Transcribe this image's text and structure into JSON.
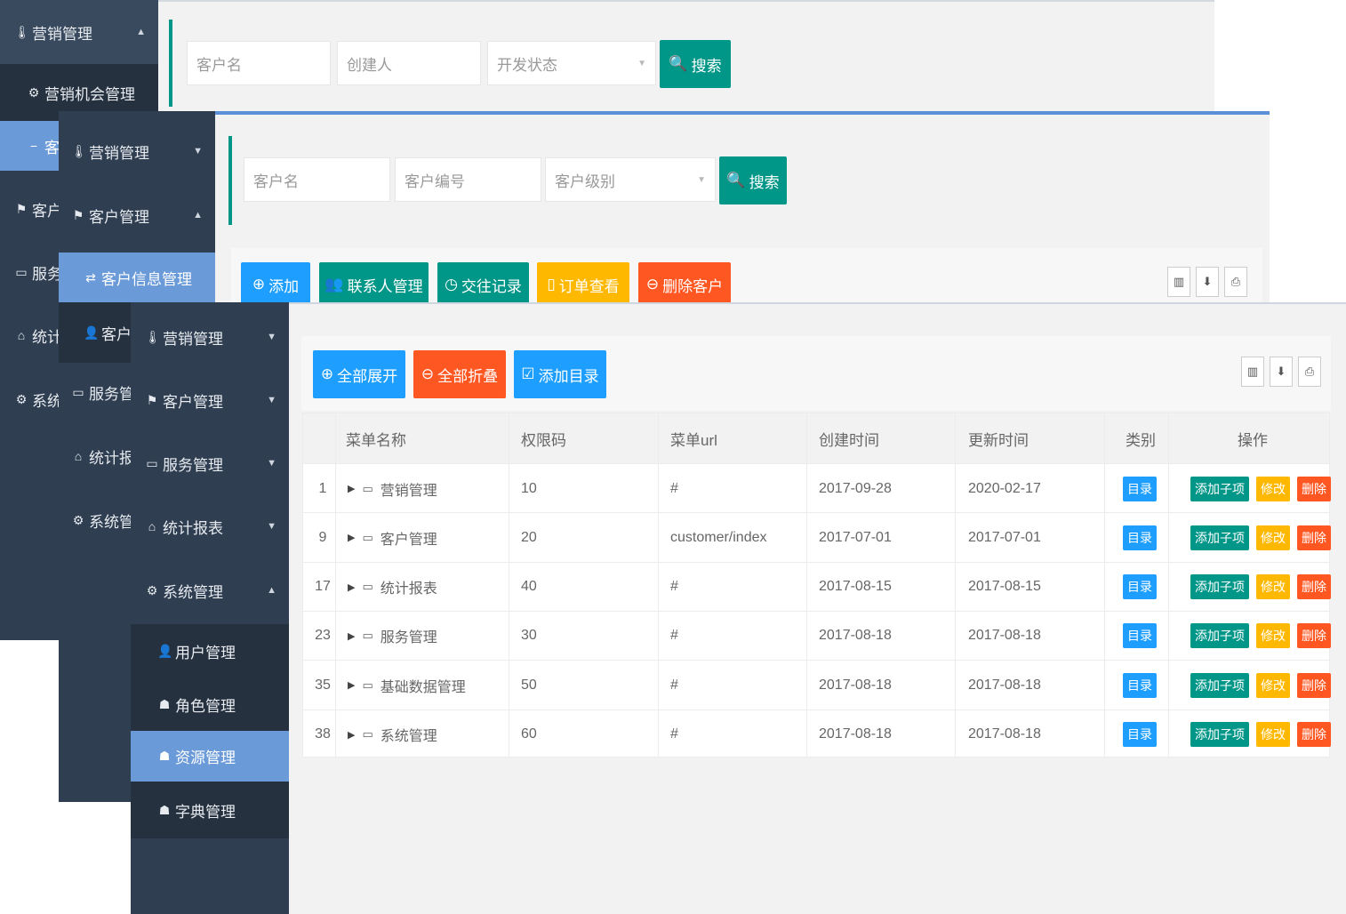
{
  "layer1": {
    "nav": {
      "marketing": "营销管理",
      "opportunity": "营销机会管理",
      "customer_partial": "客",
      "customer_mgmt_partial": "客户管",
      "service_partial": "服务",
      "stats_partial": "统计报",
      "system_partial": "系统管"
    },
    "search": {
      "customer_name_placeholder": "客户名",
      "creator_placeholder": "创建人",
      "dev_status_placeholder": "开发状态",
      "search_label": "搜索"
    }
  },
  "layer2": {
    "nav": {
      "marketing": "营销管理",
      "customer": "客户管理",
      "customer_info": "客户信息管理",
      "customer_loss_partial": "客户",
      "service": "服务管理",
      "stats": "统计报表",
      "system": "系统管理"
    },
    "search": {
      "customer_name_placeholder": "客户名",
      "customer_no_placeholder": "客户编号",
      "customer_level_placeholder": "客户级别",
      "search_label": "搜索"
    },
    "toolbar": {
      "add": "添加",
      "contacts": "联系人管理",
      "records": "交往记录",
      "orders": "订单查看",
      "delete": "删除客户"
    }
  },
  "layer3": {
    "nav": {
      "marketing": "营销管理",
      "customer": "客户管理",
      "service": "服务管理",
      "stats": "统计报表",
      "system": "系统管理",
      "users": "用户管理",
      "roles": "角色管理",
      "resources": "资源管理",
      "dictionary": "字典管理"
    },
    "toolbar": {
      "expand_all": "全部展开",
      "collapse_all": "全部折叠",
      "add_directory": "添加目录"
    },
    "table": {
      "headers": [
        "菜单名称",
        "权限码",
        "菜单url",
        "创建时间",
        "更新时间",
        "类别",
        "操作"
      ],
      "rows": [
        {
          "id": "1",
          "name": "营销管理",
          "code": "10",
          "url": "#",
          "created": "2017-09-28",
          "updated": "2020-02-17",
          "type": "目录"
        },
        {
          "id": "9",
          "name": "客户管理",
          "code": "20",
          "url": "customer/index",
          "created": "2017-07-01",
          "updated": "2017-07-01",
          "type": "目录"
        },
        {
          "id": "17",
          "name": "统计报表",
          "code": "40",
          "url": "#",
          "created": "2017-08-15",
          "updated": "2017-08-15",
          "type": "目录"
        },
        {
          "id": "23",
          "name": "服务管理",
          "code": "30",
          "url": "#",
          "created": "2017-08-18",
          "updated": "2017-08-18",
          "type": "目录"
        },
        {
          "id": "35",
          "name": "基础数据管理",
          "code": "50",
          "url": "#",
          "created": "2017-08-18",
          "updated": "2017-08-18",
          "type": "目录"
        },
        {
          "id": "38",
          "name": "系统管理",
          "code": "60",
          "url": "#",
          "created": "2017-08-18",
          "updated": "2017-08-18",
          "type": "目录"
        }
      ],
      "actions": {
        "add_child": "添加子项",
        "edit": "修改",
        "delete": "删除"
      }
    }
  },
  "colors": {
    "sidebar": "#2f3e51",
    "sidebar_sub": "#26313f",
    "active": "#6a9ad8",
    "teal": "#009688",
    "blue": "#1e9fff",
    "orange": "#ffb800",
    "red": "#ff5722"
  },
  "icons": [
    "thermometer-icon",
    "gear-icon",
    "flag-icon",
    "monitor-icon",
    "home-icon",
    "cogs-icon",
    "search-icon",
    "plus-circle-icon",
    "users-icon",
    "clock-icon",
    "clipboard-icon",
    "minus-circle-icon",
    "check-shield-icon",
    "columns-icon",
    "export-icon",
    "print-icon",
    "caret-right-icon",
    "window-icon"
  ]
}
